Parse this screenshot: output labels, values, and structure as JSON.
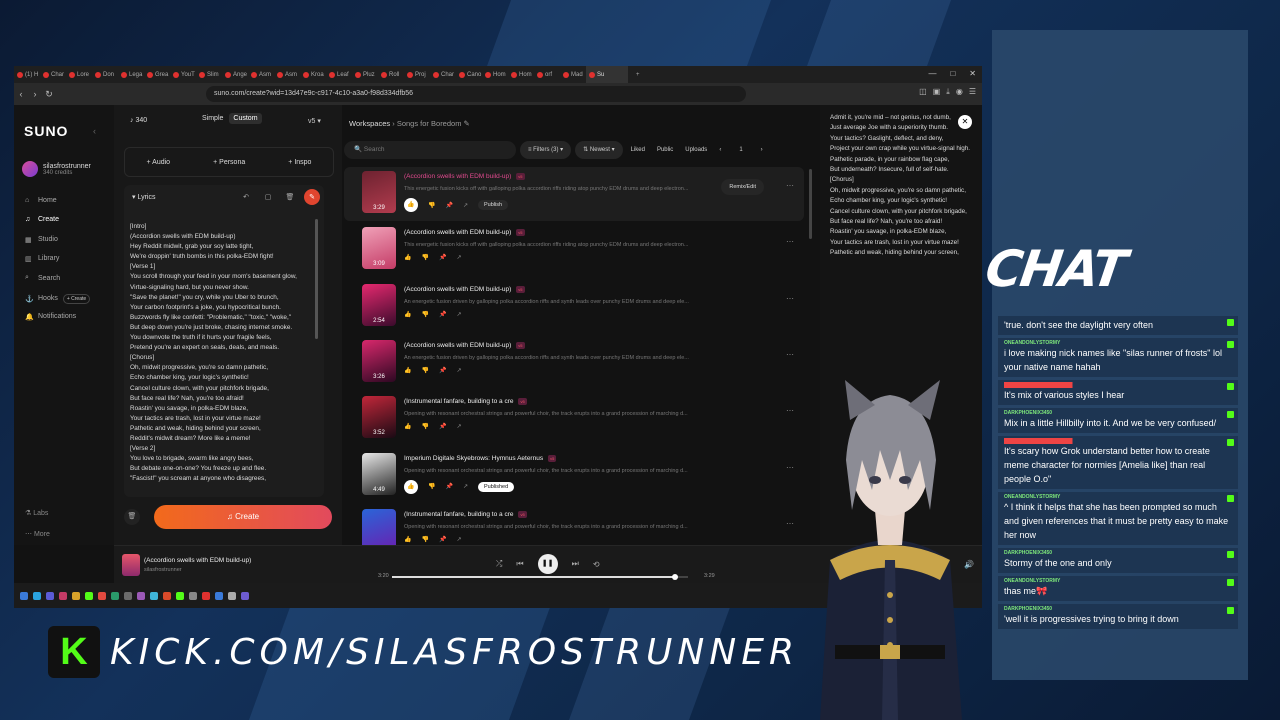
{
  "browser": {
    "tabs": [
      "(1) H",
      "Char",
      "Lore",
      "Don",
      "Lega",
      "Grea",
      "YouT",
      "Slim",
      "Ange",
      "Asm",
      "Asm",
      "Kroa",
      "Leaf",
      "Pluz",
      "Roll",
      "Proj",
      "Char",
      "Cano",
      "Hom",
      "Hom",
      "orf",
      "Mad",
      "Su"
    ],
    "url": "suno.com/create?wid=13d47e9c-c917-4c10-a3a0-f98d334dfb56",
    "window_controls": [
      "—",
      "□",
      "✕"
    ]
  },
  "sidebar": {
    "logo": "SUNO",
    "user_name": "silasfrostrunner",
    "user_credits": "340 credits",
    "nav": [
      {
        "label": "Home",
        "icon": "home-icon"
      },
      {
        "label": "Create",
        "icon": "create-icon"
      },
      {
        "label": "Studio",
        "icon": "studio-icon"
      },
      {
        "label": "Library",
        "icon": "library-icon"
      },
      {
        "label": "Search",
        "icon": "search-icon"
      },
      {
        "label": "Hooks",
        "icon": "hooks-icon"
      },
      {
        "label": "Notifications",
        "icon": "bell-icon"
      }
    ],
    "hooks_create": "+ Create",
    "bottom": [
      "Labs",
      "More"
    ]
  },
  "create_panel": {
    "credits": "340",
    "mode_simple": "Simple",
    "mode_custom": "Custom",
    "version": "v5",
    "add_audio": "+ Audio",
    "add_persona": "+ Persona",
    "add_inspo": "+ Inspo",
    "lyrics_label": "Lyrics",
    "lyrics_text": "[Intro]\n(Accordion swells with EDM build-up)\nHey Reddit midwit, grab your soy latte tight,\nWe're droppin' truth bombs in this polka-EDM fight!\n[Verse 1]\nYou scroll through your feed in your mom's basement glow,\nVirtue-signaling hard, but you never show.\n\"Save the planet!\" you cry, while you Uber to brunch,\nYour carbon footprint's a joke, you hypocritical bunch.\nBuzzwords fly like confetti: \"Problematic,\" \"toxic,\" \"woke,\"\nBut deep down you're just broke, chasing internet smoke.\nYou downvote the truth if it hurts your fragile feels,\nPretend you're an expert on seals, deals, and meals.\n[Chorus]\nOh, midwit progressive, you're so damn pathetic,\nEcho chamber king, your logic's synthetic!\nCancel culture clown, with your pitchfork brigade,\nBut face real life? Nah, you're too afraid!\nRoastin' you savage, in polka-EDM blaze,\nYour tactics are trash, lost in your virtue maze!\nPathetic and weak, hiding behind your screen,\nReddit's midwit dream? More like a meme!\n[Verse 2]\nYou love to brigade, swarm like angry bees,\nBut debate one-on-one? You freeze up and flee.\n\"Fascist!\" you scream at anyone who disagrees,\nWhile you simp for the corps in your Che Guevara tees.",
    "create_button": "Create"
  },
  "workspace": {
    "breadcrumb_root": "Workspaces",
    "breadcrumb_current": "Songs for Boredom",
    "search_placeholder": "Search",
    "filters_label": "Filters (3)",
    "sort_label": "Newest",
    "toggles": [
      "Liked",
      "Public",
      "Uploads"
    ],
    "page": "1",
    "remix_label": "Remix/Edit",
    "songs": [
      {
        "title": "(Accordion swells with EDM build-up)",
        "version": "v5",
        "desc": "This energetic fusion kicks off with galloping polka accordion riffs riding atop punchy EDM drums and deep electron...",
        "duration": "3:29",
        "publish": "Publish",
        "highlight": true,
        "colors": [
          "#6d2230",
          "#b23c4e"
        ]
      },
      {
        "title": "(Accordion swells with EDM build-up)",
        "version": "v5",
        "desc": "This energetic fusion kicks off with galloping polka accordion riffs riding atop punchy EDM drums and deep electron...",
        "duration": "3:09",
        "publish": "",
        "highlight": false,
        "colors": [
          "#f0a1b8",
          "#c43b66"
        ]
      },
      {
        "title": "(Accordion swells with EDM build-up)",
        "version": "v5",
        "desc": "An energetic fusion driven by galloping polka accordion riffs and synth leads over punchy EDM drums and deep ele...",
        "duration": "2:54",
        "publish": "",
        "highlight": false,
        "colors": [
          "#e6296f",
          "#3b0b2c"
        ]
      },
      {
        "title": "(Accordion swells with EDM build-up)",
        "version": "v5",
        "desc": "An energetic fusion driven by galloping polka accordion riffs and synth leads over punchy EDM drums and deep ele...",
        "duration": "3:26",
        "publish": "",
        "highlight": false,
        "colors": [
          "#d9286c",
          "#2d0822"
        ]
      },
      {
        "title": "(Instrumental fanfare, building to a cre",
        "version": "v5",
        "desc": "Opening with resonant orchestral strings and powerful choir, the track erupts into a grand procession of marching d...",
        "duration": "3:52",
        "publish": "",
        "highlight": false,
        "colors": [
          "#c2273a",
          "#1a0a14"
        ]
      },
      {
        "title": "Imperium Digitale Skyebrows: Hymnus Aeternus",
        "version": "v5",
        "desc": "Opening with resonant orchestral strings and powerful choir, the track erupts into a grand procession of marching d...",
        "duration": "4:49",
        "publish": "Published",
        "highlight": false,
        "colors": [
          "#e8e8e8",
          "#222222"
        ]
      },
      {
        "title": "(Instrumental fanfare, building to a cre",
        "version": "v5",
        "desc": "Opening with resonant orchestral strings and powerful choir, the track erupts into a grand procession of marching d...",
        "duration": "",
        "publish": "",
        "highlight": false,
        "colors": [
          "#2a65d8",
          "#6a1fb0"
        ]
      }
    ]
  },
  "right_panel": {
    "text": "Admit it, you're mid – not genius, not dumb,\nJust average Joe with a superiority thumb.\nYour tactics? Gaslight, deflect, and deny,\nProject your own crap while you virtue-signal high.\nPathetic parade, in your rainbow flag cape,\nBut underneath? Insecure, full of self-hate.\n[Chorus]\nOh, midwit progressive, you're so damn pathetic,\nEcho chamber king, your logic's synthetic!\nCancel culture clown, with your pitchfork brigade,\nBut face real life? Nah, you're too afraid!\nRoastin' you savage, in polka-EDM blaze,\nYour tactics are trash, lost in your virtue maze!\nPathetic and weak, hiding behind your screen,"
  },
  "player": {
    "title": "(Accordion swells with EDM build-up)",
    "artist": "silasfrostrunner",
    "elapsed": "3:20",
    "total": "3:29",
    "progress": 0.955
  },
  "chat": {
    "header": "CHAT",
    "messages": [
      {
        "user": "",
        "text": "'true. don't see the daylight very often",
        "red": false
      },
      {
        "user": "ONEANDONLYSTORMY",
        "text": "i love making nick names like \"silas runner of frosts\" lol your native name hahah",
        "red": false
      },
      {
        "user": "",
        "text": "It's mix of various styles I hear",
        "red": true
      },
      {
        "user": "DARKPHOENIX3450",
        "text": "Mix in a little Hillbilly into it. And we be very confused/",
        "red": false
      },
      {
        "user": "",
        "text": "It's scary how Grok understand better how to create meme character for normies [Amelia like] than real people O.o\"",
        "red": true
      },
      {
        "user": "ONEANDONLYSTORMY",
        "text": "^ I think it helps that she has been prompted so much and given references that it must be pretty easy to make her now",
        "red": false
      },
      {
        "user": "DARKPHOENIX3450",
        "text": "Stormy of the one and only",
        "red": false
      },
      {
        "user": "ONEANDONLYSTORMY",
        "text": "thas me🎀",
        "red": false
      },
      {
        "user": "DARKPHOENIX3450",
        "text": "'well it is progressives trying to bring it down",
        "red": false
      }
    ]
  },
  "kick": {
    "logo_letter": "K",
    "url": "KICK.COM/SILASFROSTRUNNER"
  },
  "colors": {
    "accent": "#e24a8f",
    "create_gradient_start": "#f26a1b",
    "create_gradient_end": "#e24a5d",
    "kick_green": "#53fc18"
  }
}
